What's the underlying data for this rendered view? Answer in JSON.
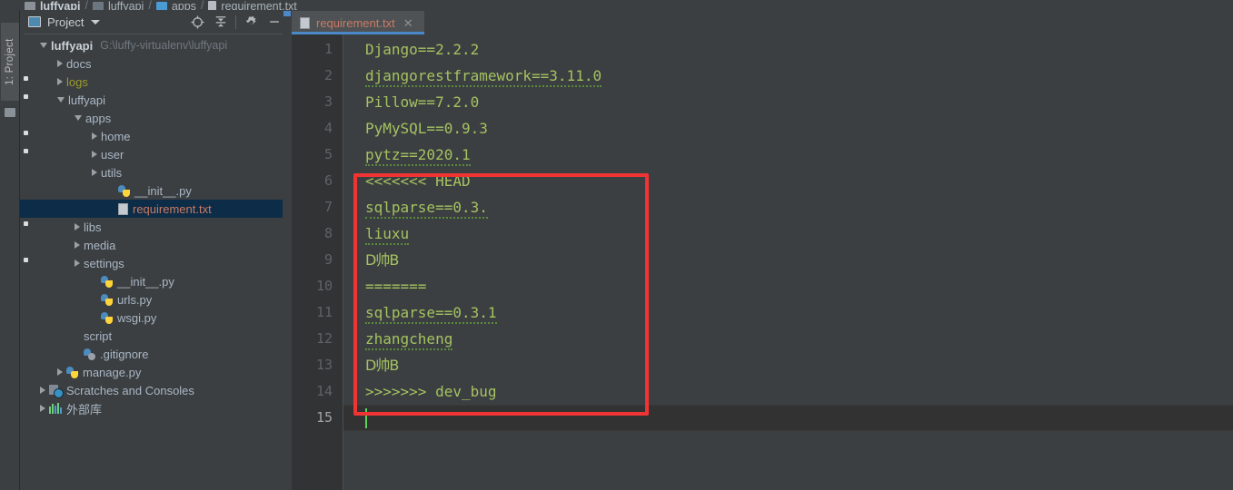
{
  "breadcrumb": {
    "items": [
      {
        "label": "luffyapi",
        "icon": "folder-grey-icon",
        "bold": true
      },
      {
        "label": "luffyapi",
        "icon": "folder-module-icon",
        "bold": false
      },
      {
        "label": "apps",
        "icon": "folder-blue-icon",
        "bold": false
      },
      {
        "label": "requirement.txt",
        "icon": "txt-file-icon",
        "bold": false
      }
    ],
    "separator": "/"
  },
  "toolstrip": {
    "project_tab_label": "1: Project",
    "folder_icon": "folder-icon"
  },
  "project_panel": {
    "title": "Project",
    "title_icon": "project-view-icon",
    "caret_icon": "chevron-down-icon",
    "tools": [
      {
        "name": "locate-in-tree-icon",
        "glyph": "crosshair"
      },
      {
        "name": "collapse-all-icon",
        "glyph": "collapse"
      },
      {
        "name": "settings-gear-icon",
        "glyph": "gear"
      },
      {
        "name": "hide-panel-icon",
        "glyph": "minus"
      }
    ]
  },
  "tree": {
    "items": [
      {
        "label": "luffyapi",
        "path": "G:\\luffy-virtualenv\\luffyapi",
        "depth": 0,
        "arrow": "down",
        "icon": "folder-grey",
        "style": "bold"
      },
      {
        "label": "docs",
        "path": "",
        "depth": 1,
        "arrow": "right",
        "icon": "folder-grey",
        "style": "normal"
      },
      {
        "label": "logs",
        "path": "",
        "depth": 1,
        "arrow": "right",
        "icon": "folder-module",
        "style": "logs"
      },
      {
        "label": "luffyapi",
        "path": "",
        "depth": 1,
        "arrow": "down",
        "icon": "folder-module",
        "style": "normal"
      },
      {
        "label": "apps",
        "path": "",
        "depth": 2,
        "arrow": "down",
        "icon": "folder-blue",
        "style": "normal"
      },
      {
        "label": "home",
        "path": "",
        "depth": 3,
        "arrow": "right",
        "icon": "folder-module",
        "style": "normal"
      },
      {
        "label": "user",
        "path": "",
        "depth": 3,
        "arrow": "right",
        "icon": "folder-module",
        "style": "normal"
      },
      {
        "label": "utils",
        "path": "",
        "depth": 3,
        "arrow": "right",
        "icon": "folder-grey",
        "style": "normal"
      },
      {
        "label": "__init__.py",
        "path": "",
        "depth": 4,
        "arrow": "none",
        "icon": "python-file",
        "style": "normal"
      },
      {
        "label": "requirement.txt",
        "path": "",
        "depth": 4,
        "arrow": "none",
        "icon": "txt-file",
        "style": "selected"
      },
      {
        "label": "libs",
        "path": "",
        "depth": 2,
        "arrow": "right",
        "icon": "folder-module",
        "style": "normal"
      },
      {
        "label": "media",
        "path": "",
        "depth": 2,
        "arrow": "right",
        "icon": "folder-grey",
        "style": "normal"
      },
      {
        "label": "settings",
        "path": "",
        "depth": 2,
        "arrow": "right",
        "icon": "folder-module",
        "style": "normal"
      },
      {
        "label": "__init__.py",
        "path": "",
        "depth": 3,
        "arrow": "none",
        "icon": "python-file",
        "style": "normal"
      },
      {
        "label": "urls.py",
        "path": "",
        "depth": 3,
        "arrow": "none",
        "icon": "python-file",
        "style": "normal"
      },
      {
        "label": "wsgi.py",
        "path": "",
        "depth": 3,
        "arrow": "none",
        "icon": "python-file",
        "style": "normal"
      },
      {
        "label": "script",
        "path": "",
        "depth": 2,
        "arrow": "none",
        "icon": "folder-grey",
        "style": "normal"
      },
      {
        "label": ".gitignore",
        "path": "",
        "depth": 2,
        "arrow": "none",
        "icon": "gitignore-file",
        "style": "normal"
      },
      {
        "label": "manage.py",
        "path": "",
        "depth": 1,
        "arrow": "right",
        "icon": "python-file",
        "style": "normal"
      },
      {
        "label": "Scratches and Consoles",
        "path": "",
        "depth": 0,
        "arrow": "right",
        "icon": "scratches",
        "style": "normal"
      },
      {
        "label": "外部库",
        "path": "",
        "depth": 0,
        "arrow": "right",
        "icon": "external-libs",
        "style": "normal"
      }
    ]
  },
  "editor": {
    "tab": {
      "label": "requirement.txt",
      "icon": "txt-file-icon",
      "close_label": "✕"
    },
    "line_numbers": [
      "1",
      "2",
      "3",
      "4",
      "5",
      "6",
      "7",
      "8",
      "9",
      "10",
      "11",
      "12",
      "13",
      "14",
      "15"
    ],
    "active_line": 15,
    "lines": [
      {
        "n": 1,
        "text": "Django==2.2.2",
        "spell": false,
        "cjk": false
      },
      {
        "n": 2,
        "text": "djangorestframework==3.11.0",
        "spell": true,
        "cjk": false
      },
      {
        "n": 3,
        "text": "Pillow==7.2.0",
        "spell": false,
        "cjk": false
      },
      {
        "n": 4,
        "text": "PyMySQL==0.9.3",
        "spell": false,
        "cjk": false
      },
      {
        "n": 5,
        "text": "pytz==2020.1",
        "spell": true,
        "cjk": false
      },
      {
        "n": 6,
        "text": "<<<<<<< HEAD",
        "spell": false,
        "cjk": false
      },
      {
        "n": 7,
        "text": "sqlparse==0.3.",
        "spell": true,
        "cjk": false
      },
      {
        "n": 8,
        "text": "liuxu",
        "spell": true,
        "cjk": false
      },
      {
        "n": 9,
        "text": "D帅B",
        "spell": false,
        "cjk": true
      },
      {
        "n": 10,
        "text": "=======",
        "spell": false,
        "cjk": false
      },
      {
        "n": 11,
        "text": "sqlparse==0.3.1",
        "spell": true,
        "cjk": false
      },
      {
        "n": 12,
        "text": "zhangcheng",
        "spell": true,
        "cjk": false
      },
      {
        "n": 13,
        "text": "D帅B",
        "spell": false,
        "cjk": true
      },
      {
        "n": 14,
        "text": ">>>>>>> dev_bug",
        "spell": false,
        "cjk": false
      },
      {
        "n": 15,
        "text": "",
        "spell": false,
        "cjk": false
      }
    ]
  },
  "annotation": {
    "name": "merge-conflict-highlight-box",
    "color": "#f03434",
    "covers_lines": "6-14"
  },
  "colors": {
    "editor_bg": "#3c3f41",
    "gutter_bg": "#313335",
    "code_green": "#a5c261",
    "tab_accent": "#4a88c7",
    "selection_bg": "#0d2c47",
    "selected_text": "#cb7a63",
    "annotation_red": "#f03434",
    "caret_green": "#5dd25d"
  }
}
